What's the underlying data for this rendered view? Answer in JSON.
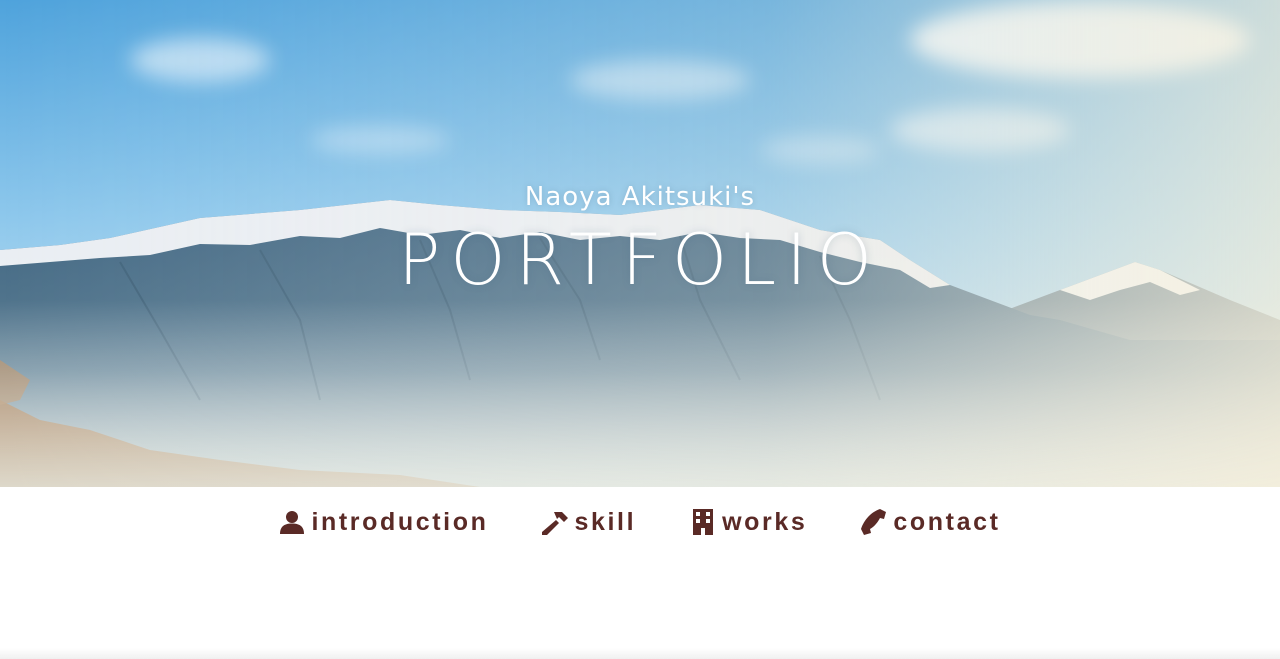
{
  "hero": {
    "subtitle": "Naoya Akitsuki's",
    "title": "PORTFOLIO",
    "image": "mountain-landscape-background"
  },
  "nav": {
    "items": [
      {
        "label": "introduction",
        "icon": "user-icon"
      },
      {
        "label": "skill",
        "icon": "hammer-icon"
      },
      {
        "label": "works",
        "icon": "building-icon"
      },
      {
        "label": "contact",
        "icon": "phone-icon"
      }
    ]
  },
  "colors": {
    "nav_text": "#5a2a26",
    "sky_top": "#5aa8de",
    "sky_bottom": "#d8eef8",
    "mountain": "#4f6f86",
    "snow": "#f2f6fa",
    "hero_text": "#ffffff",
    "background": "#ffffff"
  }
}
